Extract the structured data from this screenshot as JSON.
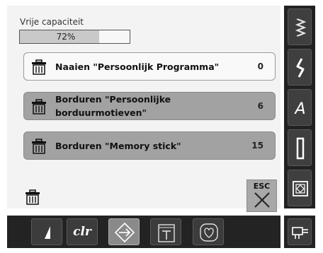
{
  "capacity": {
    "label": "Vrije capaciteit",
    "value_text": "72%",
    "fraction": 0.72
  },
  "rows": [
    {
      "label": "Naaien \"Persoonlijk Programma\"",
      "count": "0",
      "style": "light"
    },
    {
      "label": "Borduren \"Persoonlijke borduurmotieven\"",
      "count": "6",
      "style": "dark"
    },
    {
      "label": "Borduren \"Memory stick\"",
      "count": "15",
      "style": "dark"
    }
  ],
  "esc": {
    "label": "ESC"
  },
  "bottom": {
    "clr_label": "clr"
  },
  "icons": {
    "trash": "trash-icon",
    "sidebar": [
      "stitch-zigzag-icon",
      "decorative-stitch-icon",
      "alphabet-icon",
      "buttonhole-icon",
      "quilt-icon"
    ],
    "bottom": [
      "needle-stop-icon",
      "clear-icon",
      "navigation-arrows-icon",
      "stitch-type-icon",
      "favorite-icon",
      "personal-program-icon"
    ]
  },
  "colors": {
    "light_row": "#f9f9f9",
    "dark_row": "#a2a2a2",
    "bar_fill": "#c9c9c9",
    "dark_panel": "#232323"
  }
}
